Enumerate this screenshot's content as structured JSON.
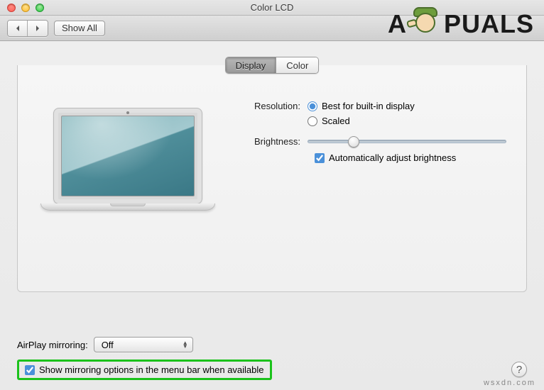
{
  "window": {
    "title": "Color LCD"
  },
  "toolbar": {
    "show_all_label": "Show All"
  },
  "tabs": {
    "display": "Display",
    "color": "Color",
    "active": "display"
  },
  "settings": {
    "resolution_label": "Resolution:",
    "resolution_options": {
      "best": "Best for built-in display",
      "scaled": "Scaled"
    },
    "resolution_selected": "best",
    "brightness_label": "Brightness:",
    "brightness_value": 23,
    "auto_brightness_label": "Automatically adjust brightness",
    "auto_brightness_checked": true
  },
  "bottom": {
    "airplay_label": "AirPlay mirroring:",
    "airplay_value": "Off",
    "show_mirroring_label": "Show mirroring options in the menu bar when available",
    "show_mirroring_checked": true,
    "help_label": "?"
  },
  "watermark": {
    "brand_left": "A",
    "brand_right": "PUALS",
    "site": "wsxdn.com"
  }
}
